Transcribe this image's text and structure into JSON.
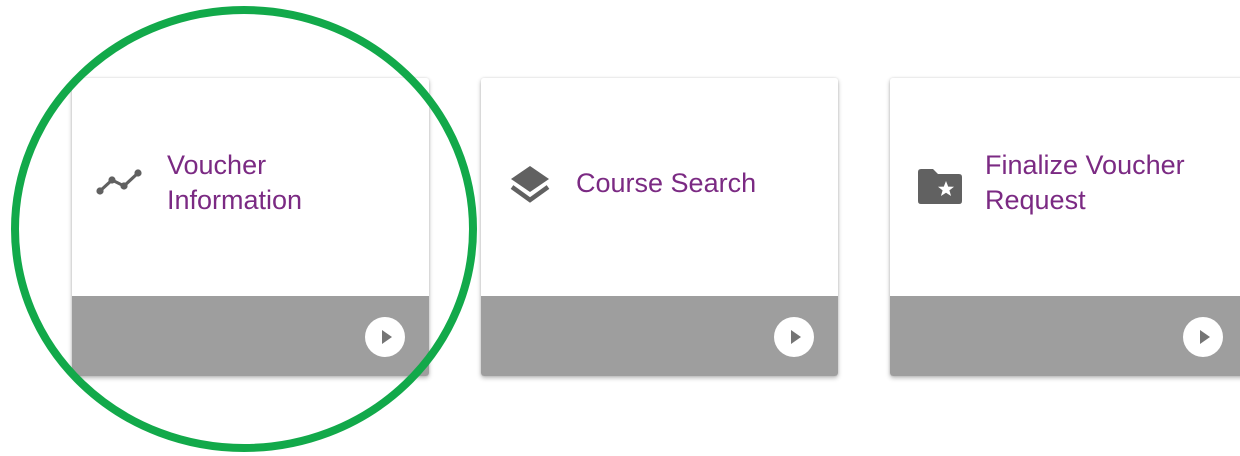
{
  "tiles": [
    {
      "title_line1": "Voucher",
      "title_line2": "Information",
      "icon": "line-chart-icon"
    },
    {
      "title_line1": "Course Search",
      "title_line2": "",
      "icon": "layers-icon"
    },
    {
      "title_line1": "Finalize Voucher",
      "title_line2": "Request",
      "icon": "folder-star-icon"
    }
  ],
  "colors": {
    "title": "#7b2a83",
    "footer": "#9e9e9e",
    "icon": "#616161",
    "highlight": "#12a94a"
  },
  "highlight": {
    "target_tile": 0
  }
}
